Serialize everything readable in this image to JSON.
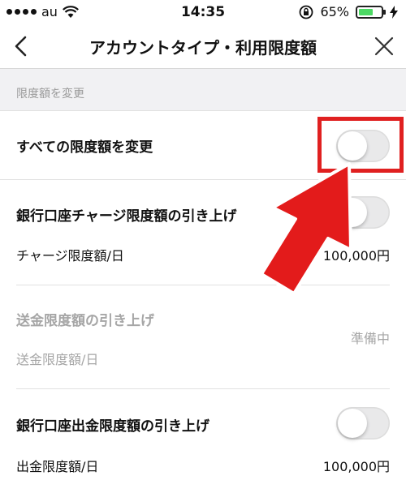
{
  "status_bar": {
    "carrier": "au",
    "time": "14:35",
    "battery_percent": "65%",
    "battery_level": 0.65,
    "icons": [
      "signal-dots",
      "wifi-icon",
      "orientation-lock-icon",
      "battery-icon",
      "charging-bolt-icon"
    ]
  },
  "nav": {
    "title": "アカウントタイプ・利用限度額",
    "back_icon": "chevron-left",
    "close_icon": "close-x"
  },
  "section_header": "限度額を変更",
  "rows": {
    "all_limits": {
      "label": "すべての限度額を変更",
      "toggle_on": false
    },
    "bank_charge": {
      "label": "銀行口座チャージ限度額の引き上げ",
      "sub_label": "チャージ限度額/日",
      "value": "100,000円",
      "toggle_on": false
    },
    "send": {
      "label": "送金限度額の引き上げ",
      "sub_label": "送金限度額/日",
      "status": "準備中"
    },
    "bank_withdraw": {
      "label": "銀行口座出金限度額の引き上げ",
      "sub_label": "出金限度額/日",
      "value": "100,000円",
      "toggle_on": false
    }
  },
  "colors": {
    "annotation_red": "#e02020",
    "toggle_off": "#e9e9ea",
    "muted_text": "#a6a6a6",
    "section_bg": "#f1f1f3"
  }
}
